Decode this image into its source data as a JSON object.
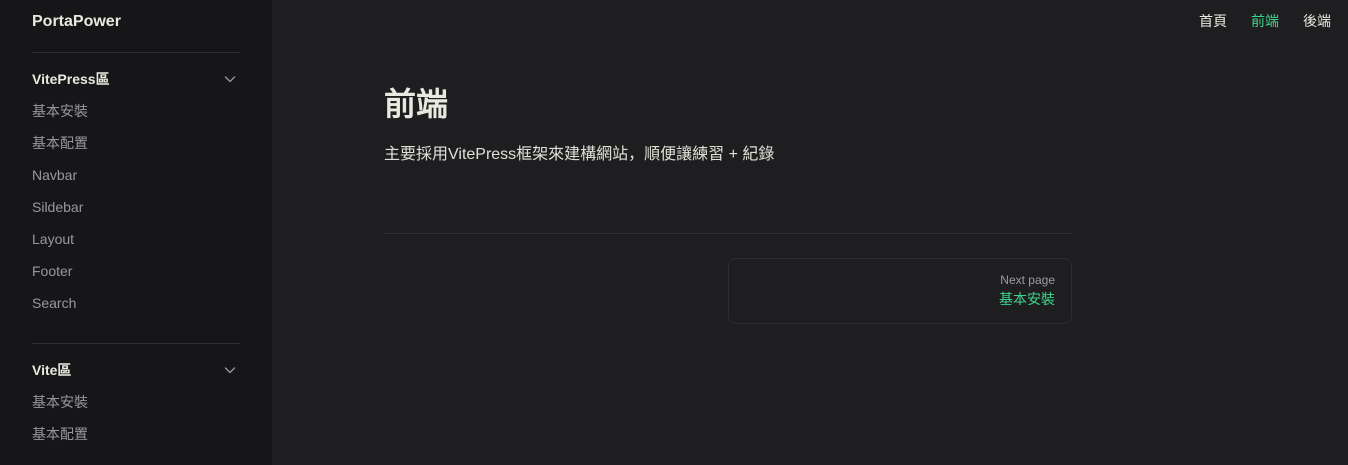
{
  "site": {
    "title": "PortaPower"
  },
  "sidebar": {
    "groups": [
      {
        "title": "VitePress區",
        "items": [
          "基本安裝",
          "基本配置",
          "Navbar",
          "Sildebar",
          "Layout",
          "Footer",
          "Search"
        ]
      },
      {
        "title": "Vite區",
        "items": [
          "基本安裝",
          "基本配置"
        ]
      }
    ]
  },
  "nav": {
    "items": [
      {
        "label": "首頁",
        "active": false
      },
      {
        "label": "前端",
        "active": true
      },
      {
        "label": "後端",
        "active": false
      }
    ]
  },
  "main": {
    "title": "前端",
    "description": "主要採用VitePress框架來建構網站，順便讓練習 + 紀錄"
  },
  "pager": {
    "next_label": "Next page",
    "next_title": "基本安裝"
  },
  "colors": {
    "accent": "#3dd68c",
    "background": "#1e1e20",
    "sidebar_background": "#161618"
  }
}
